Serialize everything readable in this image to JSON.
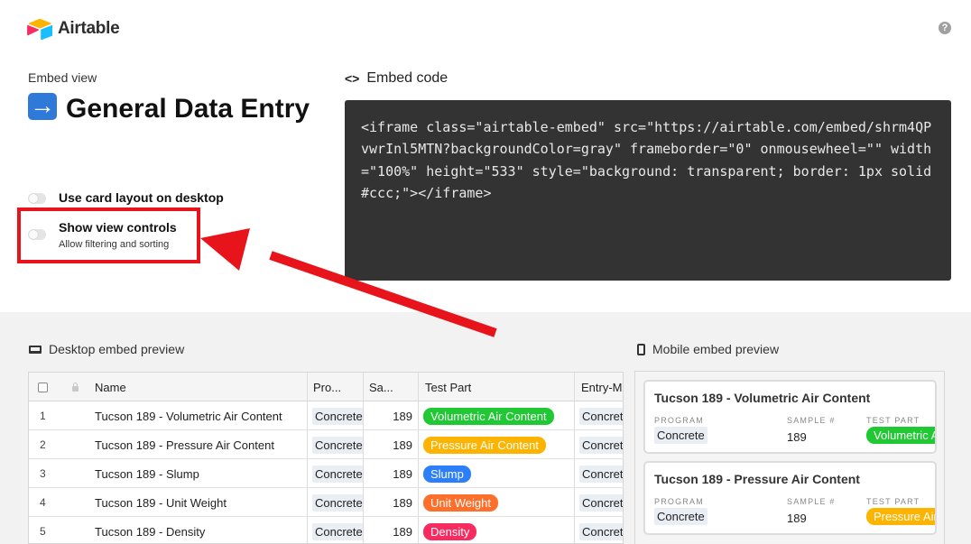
{
  "header": {
    "brand": "Airtable",
    "help": "?"
  },
  "left": {
    "embed_view_label": "Embed view",
    "view_title": "General Data Entry",
    "toggles": [
      {
        "label": "Use card layout on desktop",
        "sub": ""
      },
      {
        "label": "Show view controls",
        "sub": "Allow filtering and sorting"
      }
    ]
  },
  "embed": {
    "label": "Embed code",
    "code": "<iframe class=\"airtable-embed\" src=\"https://airtable.com/embed/shrm4QPvwrInl5MTN?backgroundColor=gray\" frameborder=\"0\" onmousewheel=\"\" width=\"100%\" height=\"533\" style=\"background: transparent; border: 1px solid #ccc;\"></iframe>"
  },
  "desktop": {
    "label": "Desktop embed preview",
    "columns": [
      "Name",
      "Pro...",
      "Sa...",
      "Test Part",
      "Entry-M"
    ],
    "rows": [
      {
        "num": "1",
        "name": "Tucson 189 - Volumetric Air Content",
        "program": "Concrete",
        "sample": "189",
        "part": "Volumetric Air Content",
        "color": "#20c933",
        "entry": "Concret"
      },
      {
        "num": "2",
        "name": "Tucson 189 - Pressure Air Content",
        "program": "Concrete",
        "sample": "189",
        "part": "Pressure Air Content",
        "color": "#fcb400",
        "entry": "Concret"
      },
      {
        "num": "3",
        "name": "Tucson 189 - Slump",
        "program": "Concrete",
        "sample": "189",
        "part": "Slump",
        "color": "#2d7ff9",
        "entry": "Concret"
      },
      {
        "num": "4",
        "name": "Tucson 189 - Unit Weight",
        "program": "Concrete",
        "sample": "189",
        "part": "Unit Weight",
        "color": "#ff6f2c",
        "entry": "Concret"
      },
      {
        "num": "5",
        "name": "Tucson 189 - Density",
        "program": "Concrete",
        "sample": "189",
        "part": "Density",
        "color": "#f82b60",
        "entry": "Concret"
      }
    ]
  },
  "mobile": {
    "label": "Mobile embed preview",
    "field_labels": [
      "PROGRAM",
      "SAMPLE #",
      "TEST PART"
    ],
    "cards": [
      {
        "title": "Tucson 189 - Volumetric Air Content",
        "program": "Concrete",
        "sample": "189",
        "part": "Volumetric Air Content",
        "color": "#20c933"
      },
      {
        "title": "Tucson 189 - Pressure Air Content",
        "program": "Concrete",
        "sample": "189",
        "part": "Pressure Air Content",
        "color": "#fcb400"
      }
    ]
  },
  "colors": {
    "highlight": "#e8141b",
    "code_bg": "#333333"
  }
}
